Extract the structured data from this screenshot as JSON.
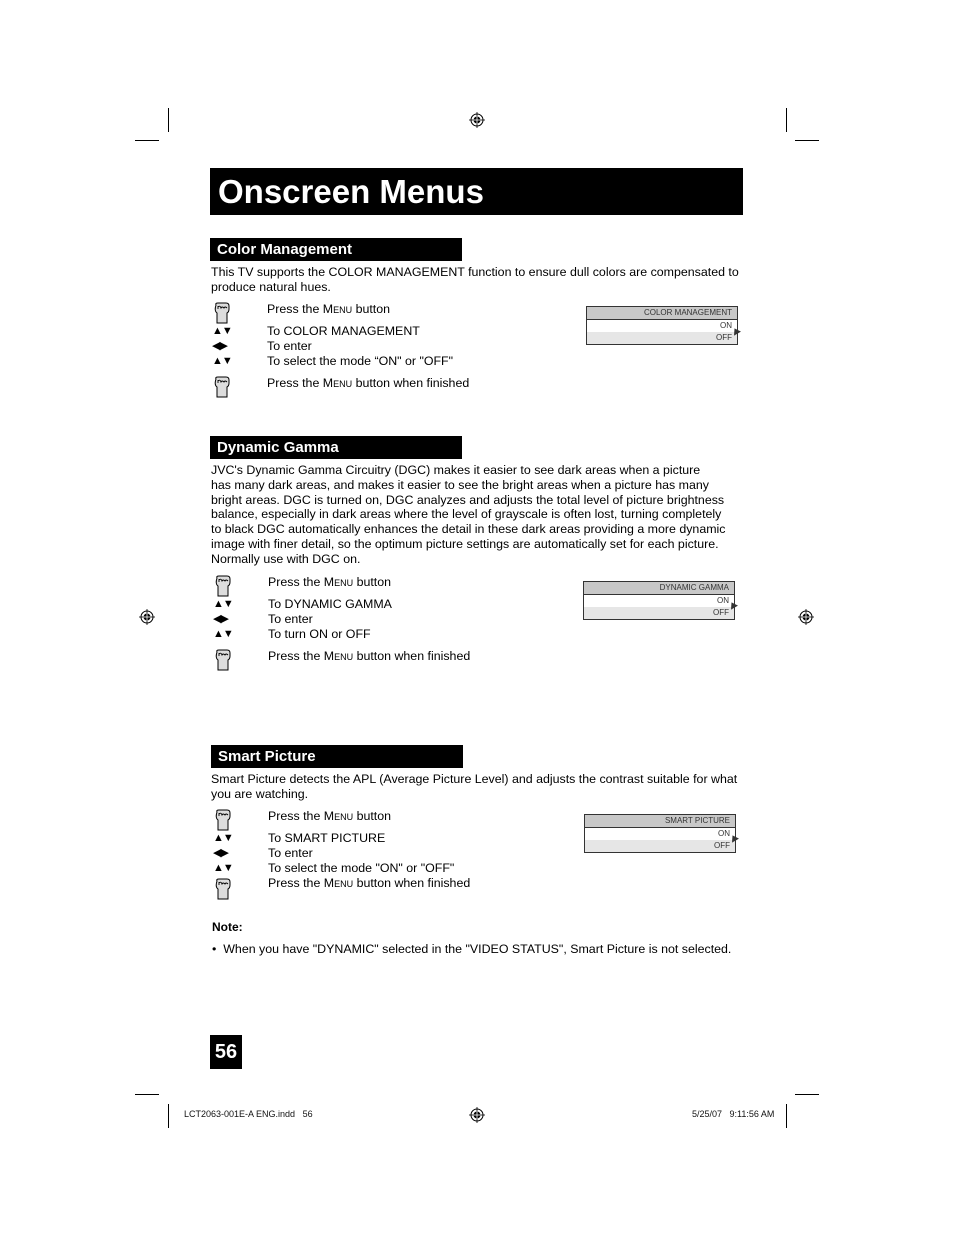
{
  "page_title": "Onscreen Menus",
  "sections": [
    {
      "heading": "Color Management",
      "description": "This TV supports the COLOR MANAGEMENT function to ensure dull colors are compensated to produce natural hues.",
      "steps": [
        {
          "icon": "hand-press-icon",
          "pre": "Press the ",
          "key": "Menu",
          "post": " button"
        },
        {
          "icon": "up-down-arrows-icon",
          "text": "To COLOR MANAGEMENT"
        },
        {
          "icon": "left-right-arrows-icon",
          "text": "To enter"
        },
        {
          "icon": "up-down-arrows-icon",
          "text": "To select the mode “ON\" or \"OFF\""
        },
        {
          "icon": "hand-press-icon",
          "pre": "Press the ",
          "key": "Menu",
          "post": " button when finished"
        }
      ],
      "osd": {
        "header": "COLOR MANAGEMENT",
        "options": [
          "ON",
          "OFF"
        ]
      }
    },
    {
      "heading": "Dynamic Gamma",
      "description_lines": [
        "JVC's Dynamic Gamma Circuitry (DGC) makes it easier to see dark areas when a picture",
        "has many dark areas, and makes it easier to see the bright areas when a picture has many",
        "bright areas.  DGC is turned on, DGC analyzes and adjusts the total level of picture brightness",
        "balance, especially in dark areas where the level of grayscale is often lost, turning completely",
        "to black DGC automatically enhances the detail in these dark areas providing a more dynamic",
        "image with finer detail, so the optimum picture settings are automatically set for each picture.",
        "Normally use with DGC on."
      ],
      "steps": [
        {
          "icon": "hand-press-icon",
          "pre": "Press the ",
          "key": "Menu",
          "post": " button"
        },
        {
          "icon": "up-down-arrows-icon",
          "text": "To DYNAMIC GAMMA"
        },
        {
          "icon": "left-right-arrows-icon",
          "text": "To enter"
        },
        {
          "icon": "up-down-arrows-icon",
          "text": "To turn ON or OFF"
        },
        {
          "icon": "hand-press-icon",
          "pre": "Press the ",
          "key": "Menu",
          "post": " button when finished"
        }
      ],
      "osd": {
        "header": "DYNAMIC GAMMA",
        "options": [
          "ON",
          "OFF"
        ]
      }
    },
    {
      "heading": "Smart Picture",
      "description": "Smart Picture detects the APL (Average Picture Level) and adjusts the contrast suitable for what you are watching.",
      "steps": [
        {
          "icon": "hand-press-icon",
          "pre": "Press the ",
          "key": "Menu",
          "post": " button"
        },
        {
          "icon": "up-down-arrows-icon",
          "text": "To SMART PICTURE"
        },
        {
          "icon": "left-right-arrows-icon",
          "text": "To enter"
        },
        {
          "icon": "up-down-arrows-icon",
          "text": "To select the mode \"ON\" or \"OFF\""
        },
        {
          "icon": "hand-press-icon",
          "pre": "Press the ",
          "key": "Menu",
          "post": " button when finished"
        }
      ],
      "osd": {
        "header": "SMART PICTURE",
        "options": [
          "ON",
          "OFF"
        ]
      }
    }
  ],
  "note": {
    "label": "Note:",
    "items": [
      "When you have \"DYNAMIC\" selected in the \"VIDEO STATUS\", Smart Picture is not selected."
    ]
  },
  "page_number": "56",
  "footer": {
    "file": "LCT2063-001E-A ENG.indd   56",
    "timestamp": "5/25/07   9:11:56 AM"
  },
  "glyphs": {
    "up_down": "▲▼",
    "left_right": "◀▶",
    "bullet": "•"
  }
}
